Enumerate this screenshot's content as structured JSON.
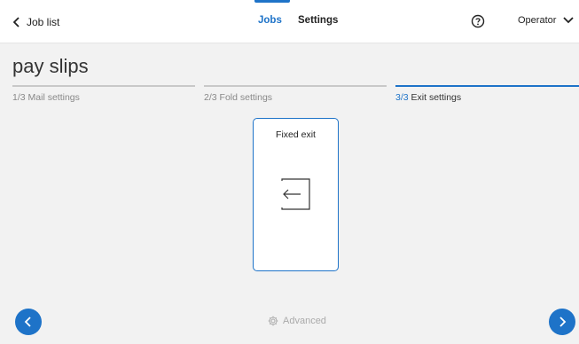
{
  "header": {
    "back_label": "Job list",
    "tabs": [
      {
        "label": "Jobs",
        "active": true
      },
      {
        "label": "Settings",
        "active": false
      }
    ],
    "user_label": "Operator",
    "accent_color": "#1e73c8"
  },
  "page": {
    "title": "pay slips"
  },
  "steps": [
    {
      "num": "1/3",
      "label": "Mail settings",
      "active": false
    },
    {
      "num": "2/3",
      "label": "Fold settings",
      "active": false
    },
    {
      "num": "3/3",
      "label": "Exit settings",
      "active": true
    }
  ],
  "exit_options": [
    {
      "label": "Fixed exit",
      "icon": "exit-arrow-icon",
      "selected": true
    }
  ],
  "footer": {
    "advanced_label": "Advanced",
    "prev_icon": "chevron-left-icon",
    "next_icon": "chevron-right-icon"
  }
}
